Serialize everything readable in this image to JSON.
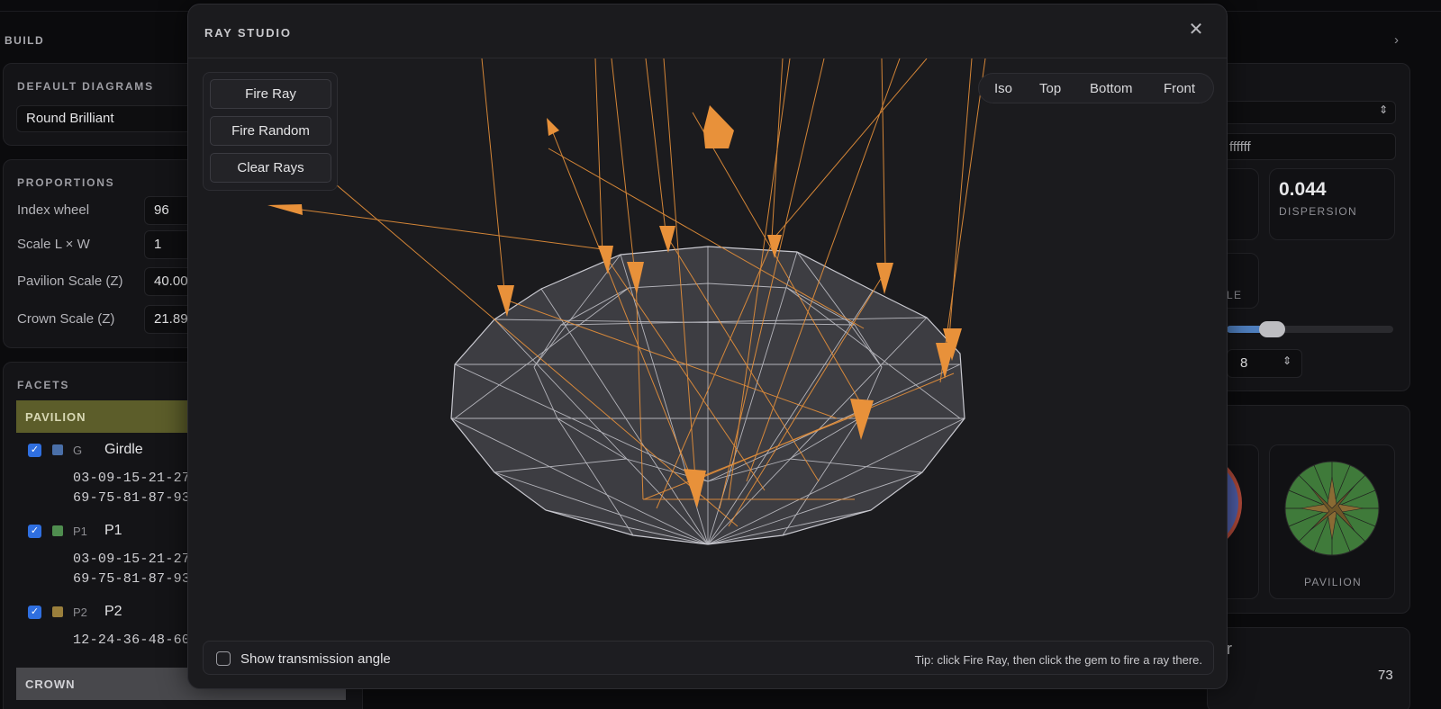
{
  "left": {
    "build_label": "BUILD",
    "default_diagrams": {
      "title": "DEFAULT DIAGRAMS",
      "value": "Round Brilliant"
    },
    "proportions": {
      "title": "PROPORTIONS",
      "rows": [
        {
          "label": "Index wheel",
          "value": "96"
        },
        {
          "label": "Scale L × W",
          "value": "1"
        },
        {
          "label": "Pavilion Scale (Z)",
          "value": "40.00"
        },
        {
          "label": "Crown Scale (Z)",
          "value": "21.89"
        }
      ]
    },
    "facets": {
      "title": "FACETS",
      "pavilion_group": "PAVILION",
      "crown_group": "CROWN",
      "items": [
        {
          "code": "G",
          "name": "Girdle",
          "indices_1": "03-09-15-21-27-",
          "indices_2": "69-75-81-87-93",
          "color": "#4a6fa8"
        },
        {
          "code": "P1",
          "name": "P1",
          "indices_1": "03-09-15-21-27-",
          "indices_2": "69-75-81-87-93",
          "color": "#4f8d4f"
        },
        {
          "code": "P2",
          "name": "P2",
          "indices_1": "12-24-36-48-60-",
          "indices_2": "",
          "color": "#9a7f3c"
        }
      ]
    }
  },
  "right": {
    "hex_value": "ffffff",
    "dispersion_value": "0.044",
    "dispersion_label": "DISPERSION",
    "partial_label": "LE",
    "stepper_value": "8",
    "pavilion_label": "PAVILION",
    "bottom_partial": "r",
    "bottom_value": "73"
  },
  "modal": {
    "title": "RAY STUDIO",
    "close_icon": "close-icon",
    "controls": {
      "fire_ray": "Fire Ray",
      "fire_random": "Fire Random",
      "clear_rays": "Clear Rays"
    },
    "views": [
      "Iso",
      "Top",
      "Bottom",
      "Front"
    ],
    "footer": {
      "toggle_label": "Show transmission angle",
      "tip": "Tip: click Fire Ray, then click the gem to fire a ray there."
    },
    "colors": {
      "ray": "#e8913a",
      "wire": "#c9c9d0",
      "gem_fill": "#4a4a4f"
    }
  }
}
